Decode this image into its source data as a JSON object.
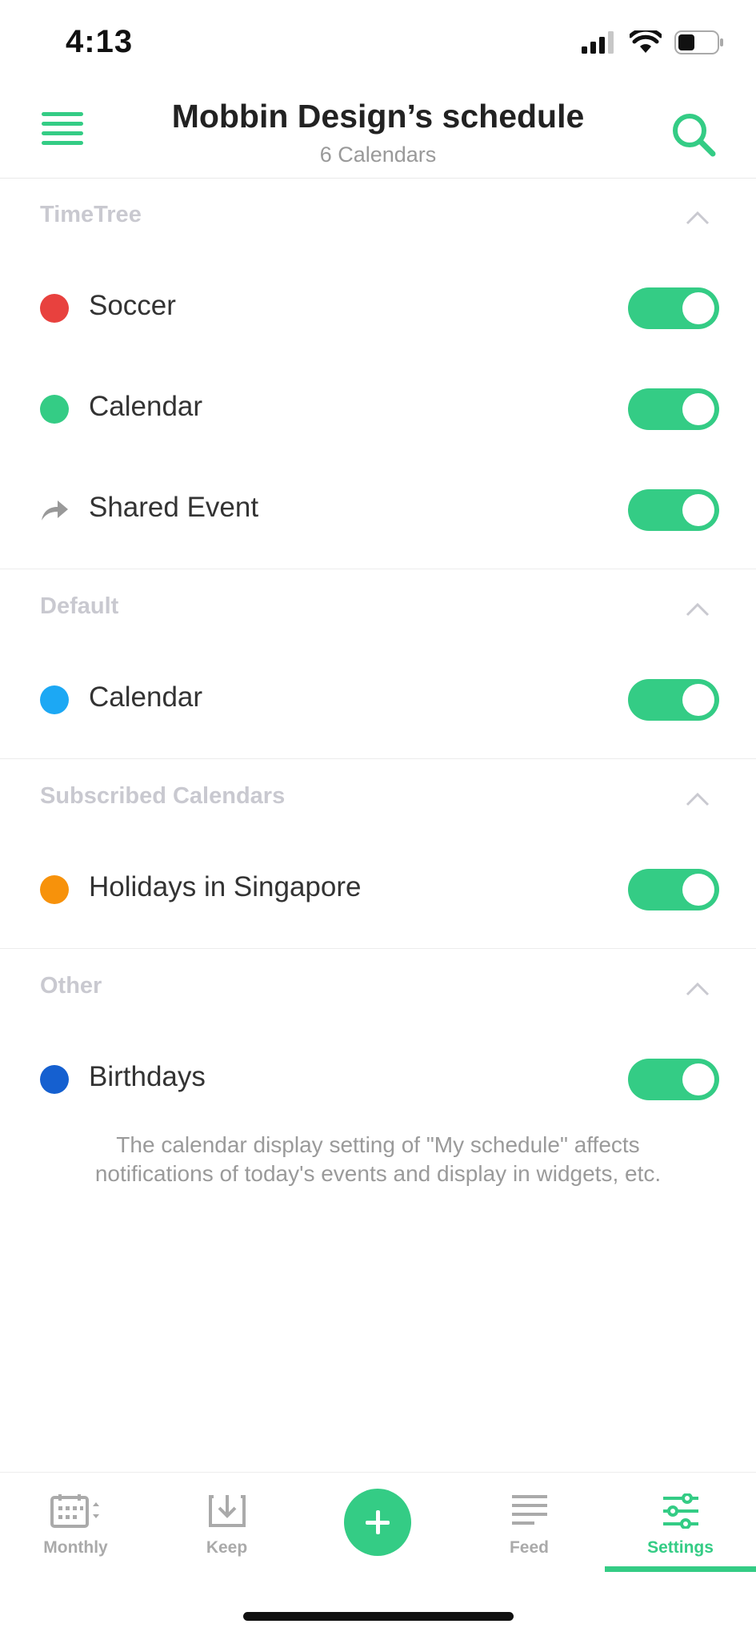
{
  "status_bar": {
    "time": "4:13"
  },
  "header": {
    "title": "Mobbin Design’s schedule",
    "subtitle": "6 Calendars"
  },
  "sections": [
    {
      "title": "TimeTree",
      "items": [
        {
          "label": "Soccer",
          "color": "#e8413e",
          "enabled": true
        },
        {
          "label": "Calendar",
          "color": "#34cc85",
          "enabled": true
        },
        {
          "label": "Shared Event",
          "icon": "share-arrow-icon",
          "enabled": true
        }
      ]
    },
    {
      "title": "Default",
      "items": [
        {
          "label": "Calendar",
          "color": "#1ca8f4",
          "enabled": true
        }
      ]
    },
    {
      "title": "Subscribed Calendars",
      "items": [
        {
          "label": "Holidays in Singapore",
          "color": "#f7920b",
          "enabled": true
        }
      ]
    },
    {
      "title": "Other",
      "items": [
        {
          "label": "Birthdays",
          "color": "#1560d0",
          "enabled": true
        }
      ]
    }
  ],
  "note": "The calendar display setting of \"My schedule\" affects notifications of today's events and display in widgets, etc.",
  "tabbar": {
    "tabs": [
      {
        "label": "Monthly",
        "icon": "calendar-icon"
      },
      {
        "label": "Keep",
        "icon": "download-tray-icon"
      },
      {
        "label": "",
        "icon": "plus-icon"
      },
      {
        "label": "Feed",
        "icon": "feed-lines-icon"
      },
      {
        "label": "Settings",
        "icon": "sliders-icon",
        "active": true
      }
    ]
  },
  "accent_color": "#34cc85"
}
